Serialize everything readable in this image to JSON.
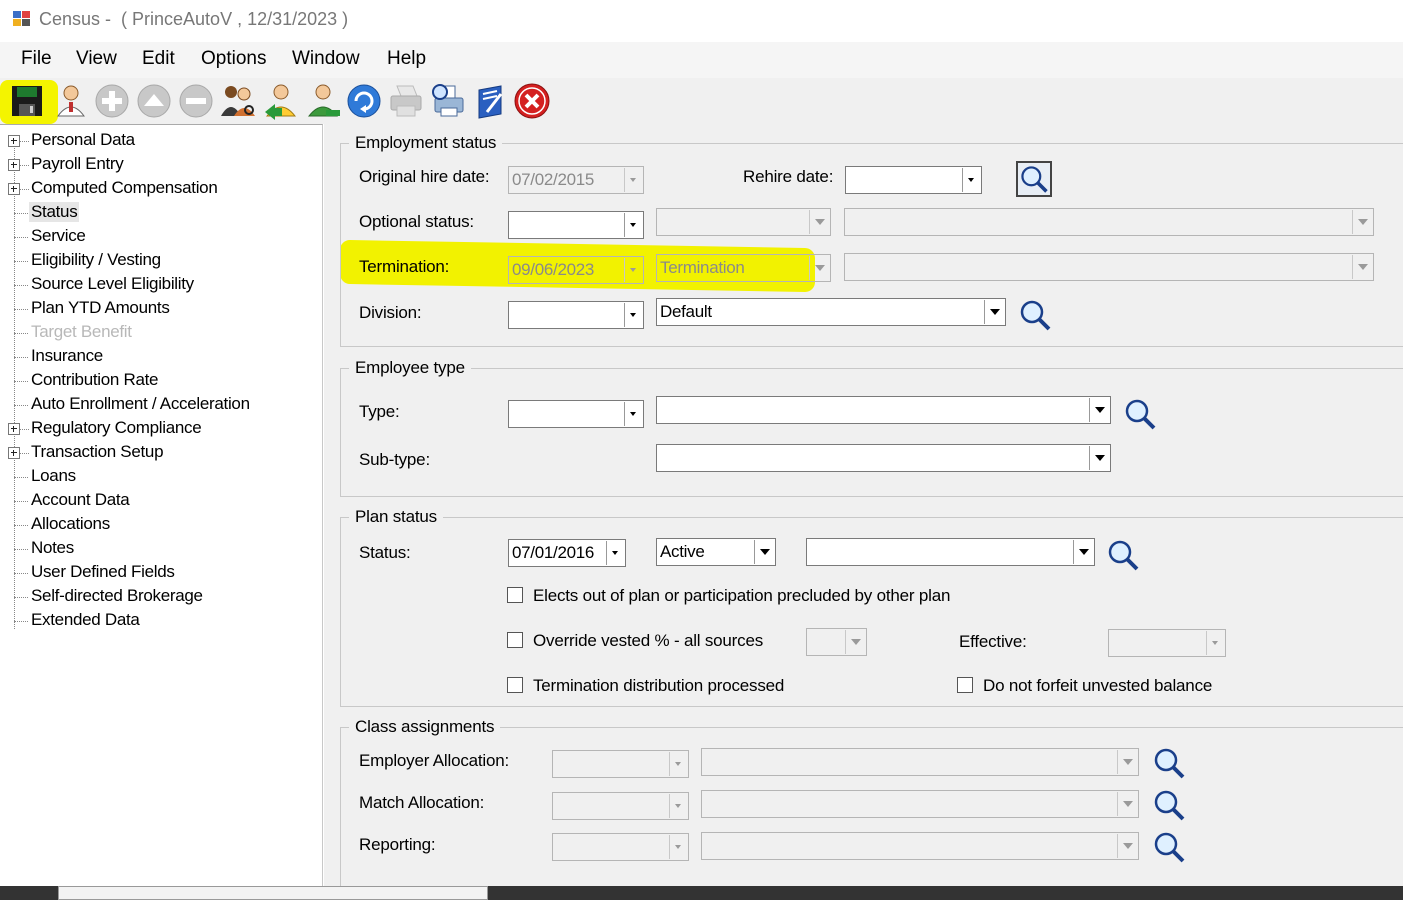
{
  "window": {
    "app_name": "Census",
    "subtitle": " -  ( PrinceAutoV , 12/31/2023 )"
  },
  "menu": [
    "File",
    "View",
    "Edit",
    "Options",
    "Window",
    "Help"
  ],
  "toolbar": {
    "icons": [
      "save-icon",
      "person-icon",
      "add-icon",
      "up-icon",
      "remove-icon",
      "group-person-icon",
      "person-add-icon",
      "person-edit-icon",
      "refresh-icon",
      "print-icon",
      "print-preview-icon",
      "notes-icon",
      "close-icon"
    ],
    "highlight_color": "#f4f400"
  },
  "tree": {
    "items": [
      {
        "label": "Personal Data",
        "expandable": true
      },
      {
        "label": "Payroll Entry",
        "expandable": true
      },
      {
        "label": "Computed Compensation",
        "expandable": true
      },
      {
        "label": "Status",
        "selected": true
      },
      {
        "label": "Service"
      },
      {
        "label": "Eligibility / Vesting"
      },
      {
        "label": "Source Level Eligibility"
      },
      {
        "label": "Plan YTD Amounts"
      },
      {
        "label": "Target Benefit",
        "disabled": true
      },
      {
        "label": "Insurance"
      },
      {
        "label": "Contribution Rate"
      },
      {
        "label": "Auto Enrollment / Acceleration"
      },
      {
        "label": "Regulatory Compliance",
        "expandable": true
      },
      {
        "label": "Transaction Setup",
        "expandable": true
      },
      {
        "label": "Loans"
      },
      {
        "label": "Account Data"
      },
      {
        "label": "Allocations"
      },
      {
        "label": "Notes"
      },
      {
        "label": "User Defined Fields"
      },
      {
        "label": "Self-directed Brokerage"
      },
      {
        "label": "Extended Data"
      }
    ]
  },
  "employment": {
    "legend": "Employment status",
    "original_hire_label": "Original hire date:",
    "original_hire_value": "07/02/2015",
    "rehire_label": "Rehire date:",
    "rehire_value": "",
    "optional_status_label": "Optional status:",
    "termination_label": "Termination:",
    "termination_date": "09/06/2023",
    "termination_reason": "Termination",
    "division_label": "Division:",
    "division_value": "Default",
    "highlight_color": "#f2f200"
  },
  "employee_type": {
    "legend": "Employee type",
    "type_label": "Type:",
    "subtype_label": "Sub-type:"
  },
  "plan_status": {
    "legend": "Plan status",
    "status_label": "Status:",
    "status_date": "07/01/2016",
    "status_value": "Active",
    "elects_out_label": "Elects out of plan or participation precluded by other plan",
    "override_vested_label": "Override vested % - all sources",
    "effective_label": "Effective:",
    "term_dist_label": "Termination distribution processed",
    "no_forfeit_label": "Do not forfeit unvested balance"
  },
  "class_assignments": {
    "legend": "Class assignments",
    "employer_alloc_label": "Employer Allocation:",
    "match_alloc_label": "Match Allocation:",
    "reporting_label": "Reporting:"
  }
}
